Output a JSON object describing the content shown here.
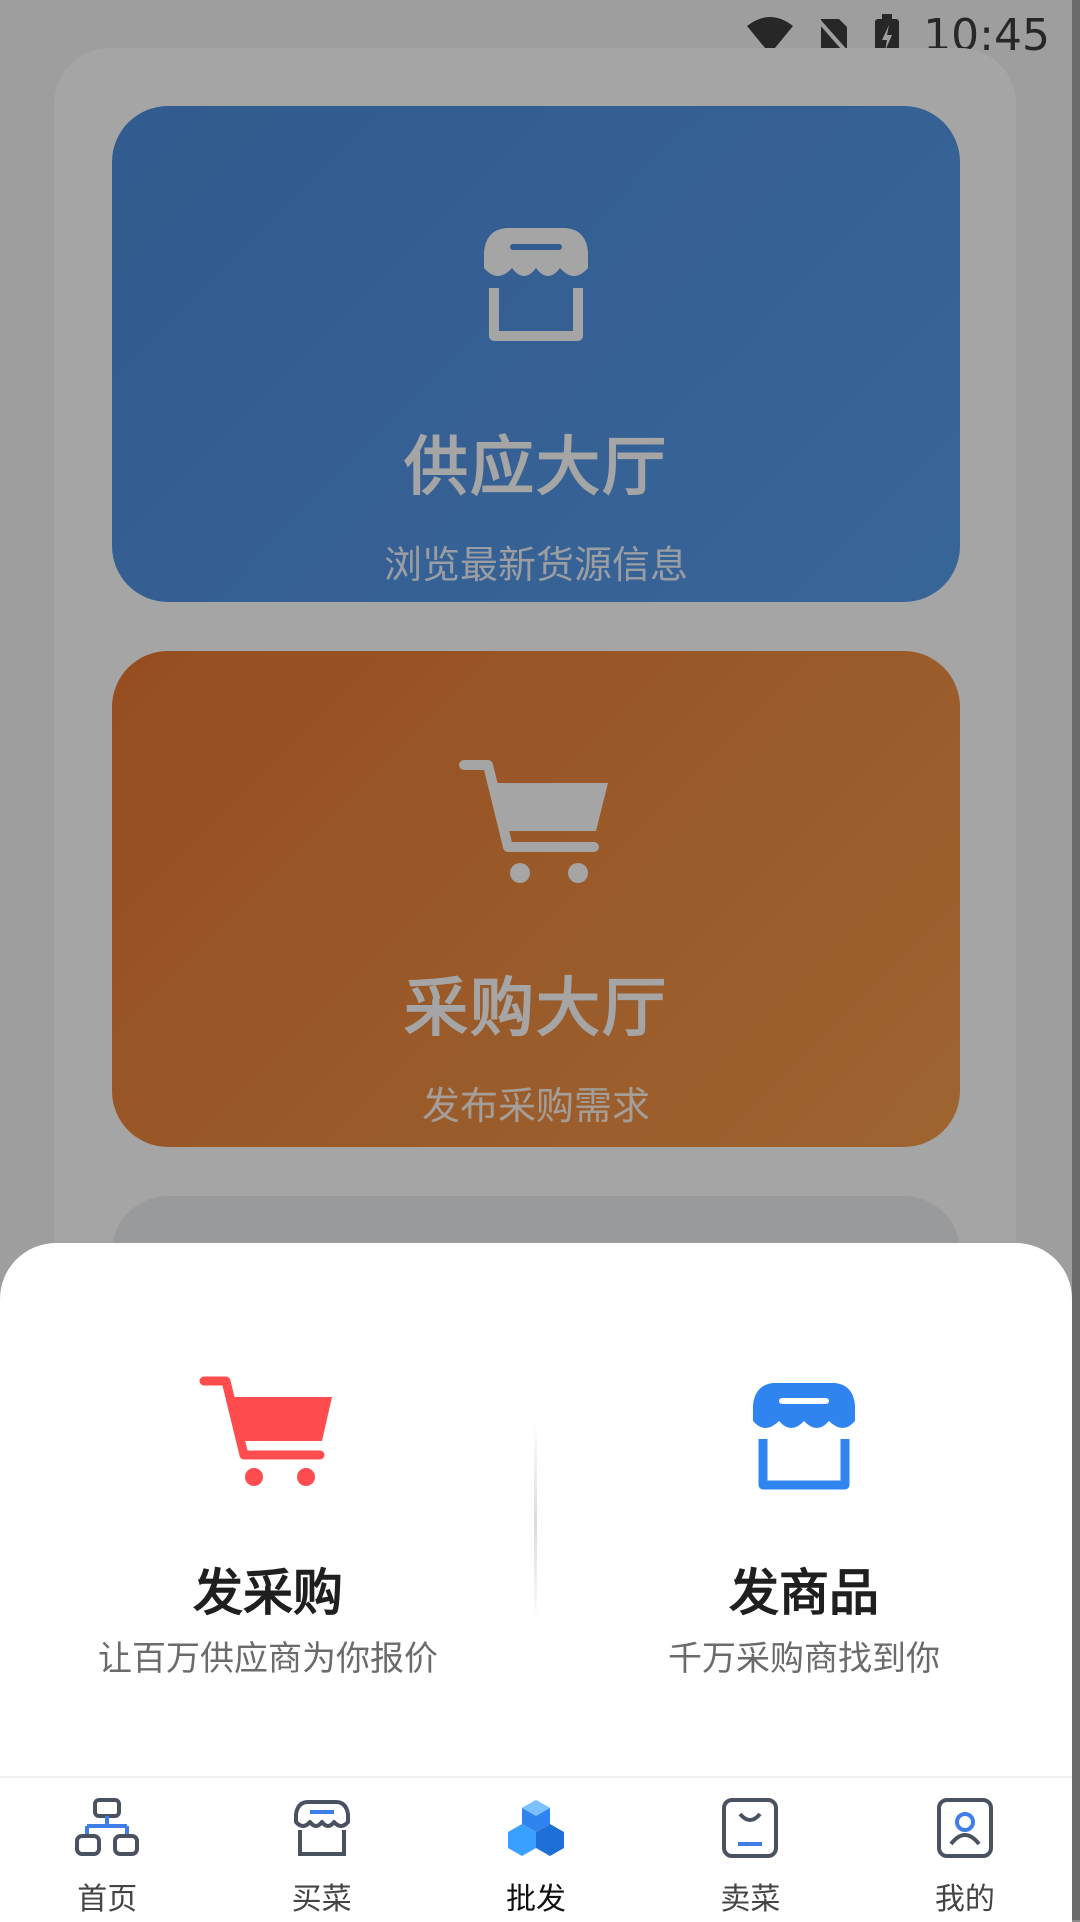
{
  "status_bar": {
    "time": "10:45",
    "icons": [
      "wifi-icon",
      "no-sim-icon",
      "battery-charging-icon"
    ]
  },
  "background": {
    "cards": [
      {
        "title": "供应大厅",
        "subtitle": "浏览最新货源信息",
        "icon": "store-icon",
        "color": "#2f78d6"
      },
      {
        "title": "采购大厅",
        "subtitle": "发布采购需求",
        "icon": "cart-icon",
        "color": "#e3610f"
      }
    ]
  },
  "sheet": {
    "options": [
      {
        "title": "发采购",
        "subtitle": "让百万供应商为你报价",
        "icon": "cart-icon",
        "color": "#ff4d4f"
      },
      {
        "title": "发商品",
        "subtitle": "千万采购商找到你",
        "icon": "store-icon",
        "color": "#2f84f0"
      }
    ]
  },
  "tabbar": {
    "tabs": [
      {
        "label": "首页",
        "icon": "sitemap-icon"
      },
      {
        "label": "买菜",
        "icon": "shop-icon"
      },
      {
        "label": "批发",
        "icon": "cubes-icon",
        "active": true
      },
      {
        "label": "卖菜",
        "icon": "box-icon"
      },
      {
        "label": "我的",
        "icon": "user-icon"
      }
    ]
  },
  "colors": {
    "accent_blue": "#2f84f0",
    "accent_red": "#ff4d4f",
    "accent_orange": "#e3610f"
  }
}
